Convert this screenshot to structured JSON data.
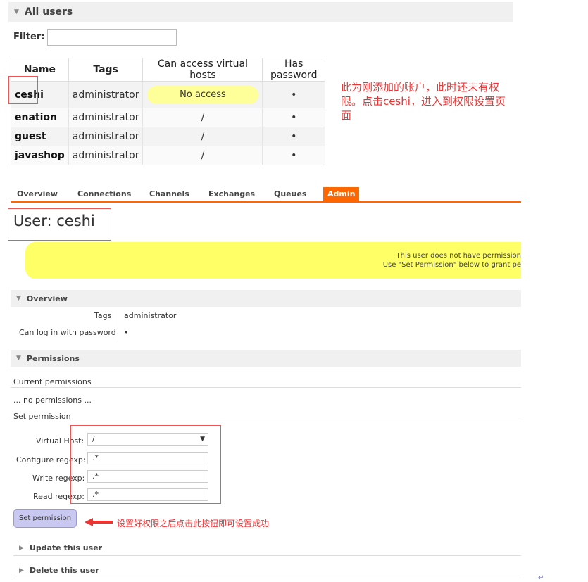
{
  "all_users": {
    "title": "All users",
    "filter_label": "Filter:",
    "filter_value": "",
    "columns": [
      "Name",
      "Tags",
      "Can access virtual hosts",
      "Has password"
    ],
    "rows": [
      {
        "name": "ceshi",
        "tags": "administrator",
        "vhosts": "No access",
        "password": "•"
      },
      {
        "name": "enation",
        "tags": "administrator",
        "vhosts": "/",
        "password": "•"
      },
      {
        "name": "guest",
        "tags": "administrator",
        "vhosts": "/",
        "password": "•"
      },
      {
        "name": "javashop",
        "tags": "administrator",
        "vhosts": "/",
        "password": "•"
      }
    ]
  },
  "annotation_top": "此为刚添加的账户，此时还未有权限。点击ceshi，进入到权限设置页面",
  "nav": {
    "overview": "Overview",
    "connections": "Connections",
    "channels": "Channels",
    "exchanges": "Exchanges",
    "queues": "Queues",
    "admin": "Admin"
  },
  "user_title": "User: ceshi",
  "warning": {
    "line1": "This user does not have permission",
    "line2": "Use \"Set Permission\" below to grant pe"
  },
  "overview_section": {
    "title": "Overview",
    "tags_label": "Tags",
    "tags_value": "administrator",
    "login_label": "Can log in with password",
    "login_value": "•"
  },
  "permissions_section": {
    "title": "Permissions",
    "current_label": "Current permissions",
    "no_permissions": "... no permissions ...",
    "set_label": "Set permission",
    "vhost_label": "Virtual Host:",
    "vhost_value": "/",
    "configure_label": "Configure regexp:",
    "configure_value": ".*",
    "write_label": "Write regexp:",
    "write_value": ".*",
    "read_label": "Read regexp:",
    "read_value": ".*",
    "button": "Set permission"
  },
  "annotation_bottom": "设置好权限之后点击此按钮即可设置成功",
  "update_user": "Update this user",
  "delete_user": "Delete this user",
  "colors": {
    "accent_orange": "#f60",
    "annotation_red": "#e33",
    "warning_yellow": "#ffff66",
    "button_purple": "#c8c8f0"
  }
}
